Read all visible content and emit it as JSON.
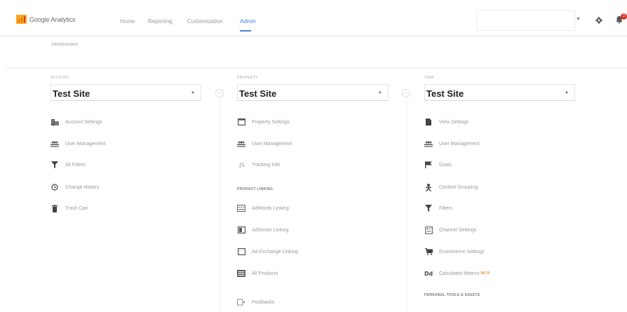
{
  "header": {
    "brand": "Google Analytics",
    "nav": [
      {
        "label": "Home",
        "active": false
      },
      {
        "label": "Reporting",
        "active": false
      },
      {
        "label": "Customization",
        "active": false
      },
      {
        "label": "Admin",
        "active": true
      }
    ],
    "search_placeholder": "",
    "notification_count": "2"
  },
  "breadcrumb": "Administration",
  "account": {
    "label": "ACCOUNT",
    "selected": "Test Site",
    "items": [
      {
        "icon": "building-icon",
        "label": "Account Settings"
      },
      {
        "icon": "users-icon",
        "label": "User Management"
      },
      {
        "icon": "filter-icon",
        "label": "All Filters"
      },
      {
        "icon": "history-icon",
        "label": "Change History"
      },
      {
        "icon": "trash-icon",
        "label": "Trash Can"
      }
    ]
  },
  "property": {
    "label": "PROPERTY",
    "selected": "Test Site",
    "items": [
      {
        "icon": "window-icon",
        "label": "Property Settings"
      },
      {
        "icon": "users-icon",
        "label": "User Management"
      },
      {
        "icon": "code-icon",
        "label": "Tracking Info"
      }
    ],
    "section_label": "PRODUCT LINKING",
    "linking": [
      {
        "icon": "adwords-icon",
        "label": "AdWords Linking"
      },
      {
        "icon": "adsense-icon",
        "label": "AdSense Linking"
      },
      {
        "icon": "ad-exchange-icon",
        "label": "Ad Exchange Linking"
      },
      {
        "icon": "products-icon",
        "label": "All Products"
      },
      {
        "icon": "postback-icon",
        "label": "Postbacks"
      }
    ]
  },
  "view": {
    "label": "VIEW",
    "selected": "Test Site",
    "items": [
      {
        "icon": "document-icon",
        "label": "View Settings"
      },
      {
        "icon": "users-icon",
        "label": "User Management"
      },
      {
        "icon": "flag-icon",
        "label": "Goals"
      },
      {
        "icon": "person-icon",
        "label": "Content Grouping"
      },
      {
        "icon": "filter-icon",
        "label": "Filters"
      },
      {
        "icon": "channel-icon",
        "label": "Channel Settings"
      },
      {
        "icon": "cart-icon",
        "label": "Ecommerce Settings"
      },
      {
        "icon": "dd-icon",
        "label": "Calculated Metrics",
        "badge": "BETA"
      }
    ],
    "section_label": "PERSONAL TOOLS & ASSETS"
  },
  "colors": {
    "accent": "#4a86d8",
    "logo_orange": "#f6a623",
    "badge_red": "#d93025"
  }
}
